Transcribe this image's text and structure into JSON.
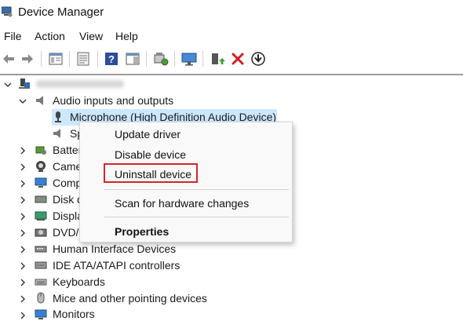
{
  "window": {
    "title": "Device Manager",
    "app_icon": "device-manager-icon"
  },
  "menubar": {
    "items": [
      "File",
      "Action",
      "View",
      "Help"
    ]
  },
  "toolbar": {
    "buttons": [
      "back-arrow-icon",
      "forward-arrow-icon",
      "properties-icon",
      "show-hide-icon",
      "help-icon",
      "action-pane-icon",
      "scan-hardware-icon",
      "monitor-icon",
      "update-driver-icon",
      "uninstall-x-icon",
      "download-driver-icon"
    ]
  },
  "tree": {
    "root_label": "",
    "nodes": [
      {
        "label": "Audio inputs and outputs",
        "expanded": true,
        "icon": "speaker-icon"
      },
      {
        "label": "Microphone (High Definition Audio Device)",
        "icon": "microphone-icon",
        "selected": true
      },
      {
        "label": "Sp",
        "icon": "speaker-icon"
      },
      {
        "label": "Batter",
        "icon": "battery-icon"
      },
      {
        "label": "Came",
        "icon": "camera-icon"
      },
      {
        "label": "Comp",
        "icon": "computer-icon"
      },
      {
        "label": "Disk d",
        "icon": "disk-drive-icon"
      },
      {
        "label": "Displa",
        "icon": "display-adapter-icon"
      },
      {
        "label": "DVD/C",
        "icon": "dvd-drive-icon"
      },
      {
        "label": "Human Interface Devices",
        "icon": "hid-icon"
      },
      {
        "label": "IDE ATA/ATAPI controllers",
        "icon": "ide-controller-icon"
      },
      {
        "label": "Keyboards",
        "icon": "keyboard-icon"
      },
      {
        "label": "Mice and other pointing devices",
        "icon": "mouse-icon"
      },
      {
        "label": "Monitors",
        "icon": "monitor-icon"
      }
    ]
  },
  "context_menu": {
    "items": [
      "Update driver",
      "Disable device",
      "Uninstall device",
      "Scan for hardware changes",
      "Properties"
    ],
    "highlight_color": "#d42626"
  },
  "colors": {
    "selection": "#cce8ff",
    "accent_red": "#d42626"
  }
}
